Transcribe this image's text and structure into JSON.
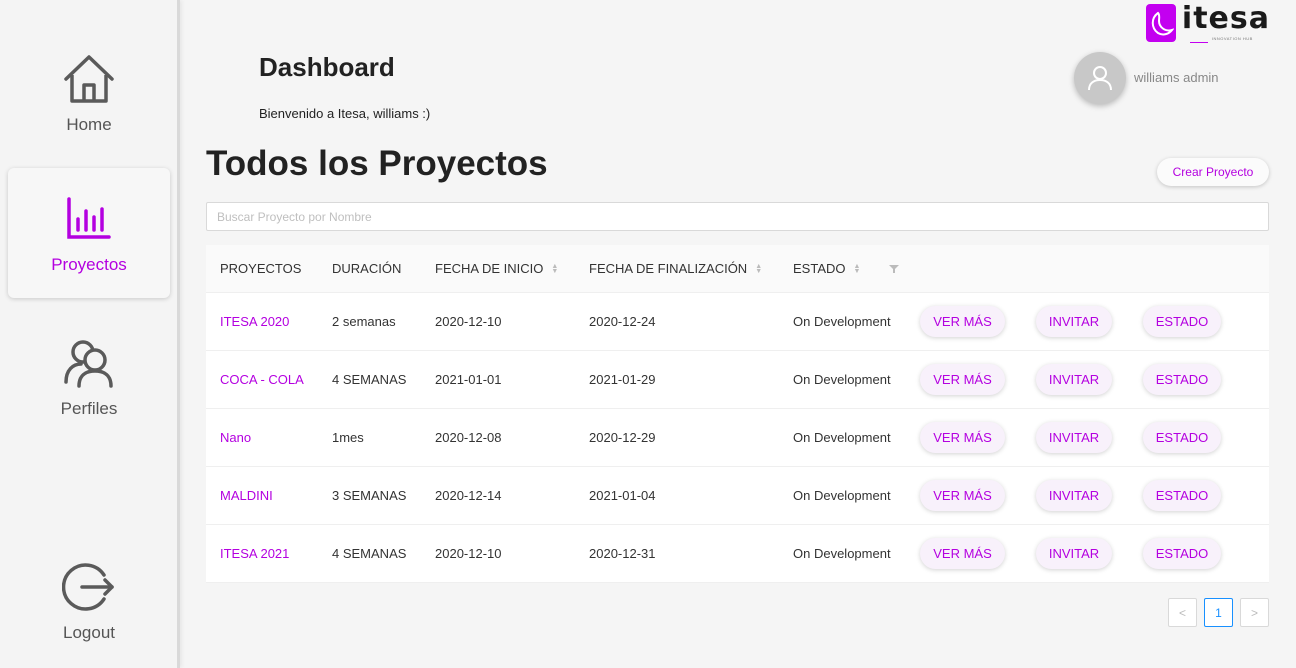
{
  "sidebar": {
    "items": [
      {
        "label": "Home",
        "icon": "home-icon"
      },
      {
        "label": "Proyectos",
        "icon": "bar-chart-icon"
      },
      {
        "label": "Perfiles",
        "icon": "users-icon"
      },
      {
        "label": "Logout",
        "icon": "logout-icon"
      }
    ],
    "active": "Proyectos"
  },
  "brand": {
    "name": "itesa",
    "tagline": "INNOVATION HUB",
    "accent": "#c300f0"
  },
  "header": {
    "title": "Dashboard",
    "welcome": "Bienvenido a Itesa, williams :)",
    "user_name": "williams admin"
  },
  "main": {
    "title": "Todos los Proyectos",
    "create_button": "Crear Proyecto",
    "search_placeholder": "Buscar Proyecto por Nombre"
  },
  "table": {
    "columns": [
      "PROYECTOS",
      "DURACIÓN",
      "FECHA DE INICIO",
      "FECHA DE FINALIZACIÓN",
      "ESTADO"
    ],
    "action_labels": {
      "view": "VER MÁS",
      "invite": "INVITAR",
      "status": "ESTADO"
    },
    "rows": [
      {
        "name": "ITESA 2020",
        "duration": "2 semanas",
        "start": "2020-12-10",
        "end": "2020-12-24",
        "state": "On Development"
      },
      {
        "name": "COCA - COLA",
        "duration": "4 SEMANAS",
        "start": "2021-01-01",
        "end": "2021-01-29",
        "state": "On Development"
      },
      {
        "name": "Nano",
        "duration": "1mes",
        "start": "2020-12-08",
        "end": "2020-12-29",
        "state": "On Development"
      },
      {
        "name": "MALDINI",
        "duration": "3 SEMANAS",
        "start": "2020-12-14",
        "end": "2021-01-04",
        "state": "On Development"
      },
      {
        "name": "ITESA 2021",
        "duration": "4 SEMANAS",
        "start": "2020-12-10",
        "end": "2020-12-31",
        "state": "On Development"
      }
    ]
  },
  "pagination": {
    "prev": "<",
    "current": "1",
    "next": ">"
  }
}
